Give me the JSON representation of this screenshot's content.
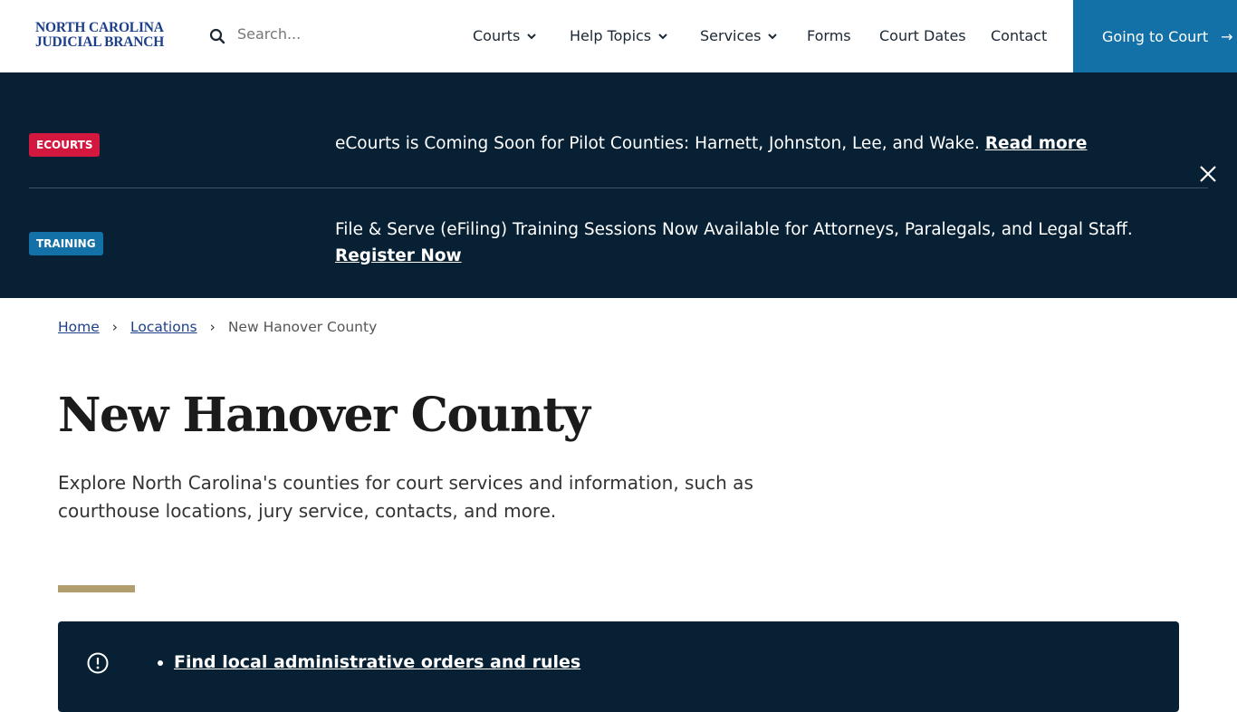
{
  "header": {
    "logo_line1": "NORTH CAROLINA",
    "logo_line2": "JUDICIAL BRANCH",
    "search_placeholder": "Search...",
    "nav": [
      {
        "label": "Courts"
      },
      {
        "label": "Help Topics"
      },
      {
        "label": "Services"
      },
      {
        "label": "Forms"
      },
      {
        "label": "Court Dates"
      },
      {
        "label": "Contact"
      }
    ],
    "cta": "Going to Court"
  },
  "alerts": [
    {
      "badge": "ECOURTS",
      "badge_color": "#d3173e",
      "text": "eCourts is Coming Soon for Pilot Counties: Harnett, Johnston, Lee, and Wake.",
      "link": "Read more"
    },
    {
      "badge": "TRAINING",
      "badge_color": "#1471a8",
      "text": "File & Serve (eFiling) Training Sessions Now Available for Attorneys, Paralegals, and Legal Staff.",
      "link": "Register Now"
    }
  ],
  "breadcrumb": {
    "home": "Home",
    "locations": "Locations",
    "current": "New Hanover County"
  },
  "page": {
    "title": "New Hanover County",
    "intro": "Explore North Carolina's counties for court services and information, such as courthouse locations, jury service, contacts, and more."
  },
  "notice": {
    "link": "Find local administrative orders and rules"
  }
}
